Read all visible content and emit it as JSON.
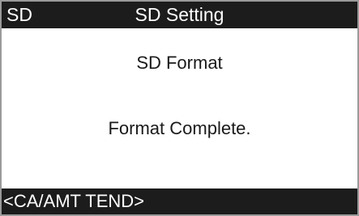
{
  "header": {
    "mode_label": "SD",
    "title": "SD Setting"
  },
  "main": {
    "heading": "SD Format",
    "message": "Format Complete."
  },
  "footer": {
    "key_hint": "<CA/AMT TEND>"
  },
  "colors": {
    "bar_background": "#1c1c1c",
    "bar_text": "#ffffff",
    "body_background": "#ffffff",
    "body_text": "#1a1a1a"
  }
}
